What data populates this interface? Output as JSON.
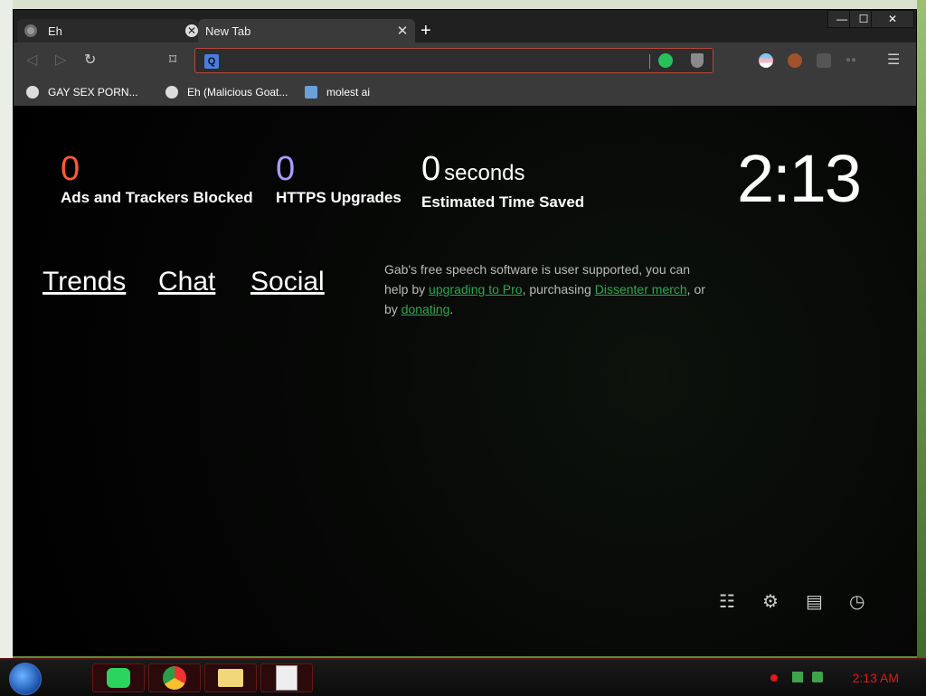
{
  "browser": {
    "tabs": [
      {
        "title": "Eh",
        "active": false
      },
      {
        "title": "New Tab",
        "active": true
      }
    ],
    "window_controls": {
      "minimize": "—",
      "maximize": "☐",
      "close": "✕"
    },
    "toolbar": {
      "address_value": "",
      "address_placeholder": "",
      "search_badge": "Q"
    },
    "bookmarks": [
      {
        "label": "GAY SEX PORN...",
        "icon": "ghost-icon"
      },
      {
        "label": "Eh (Malicious Goat...",
        "icon": "globe-icon"
      },
      {
        "label": "molest ai",
        "icon": "page-icon"
      }
    ]
  },
  "newtab": {
    "stats": [
      {
        "value": "0",
        "label": "Ads and Trackers Blocked",
        "color": "#ff5a36"
      },
      {
        "value": "0",
        "label": "HTTPS Upgrades",
        "color": "#a99cff"
      },
      {
        "value": "0",
        "unit": "seconds",
        "label": "Estimated Time Saved",
        "color": "#ffffff"
      }
    ],
    "clock": "2:13",
    "links": [
      "Trends",
      "Chat",
      "Social"
    ],
    "gab": {
      "text1": "Gab's free speech software is user supported, you can help by ",
      "link1": "upgrading to Pro",
      "text2": ", purchasing ",
      "link2": "Dissenter merch",
      "text3": ", or by ",
      "link3": "donating",
      "text4": "."
    },
    "bottom_icons": [
      "sliders-icon",
      "gear-icon",
      "bookmarks-icon",
      "history-icon"
    ]
  },
  "taskbar": {
    "time": "2:13 AM",
    "apps": [
      "chat-app-icon",
      "chrome-icon",
      "folder-icon",
      "document-icon"
    ]
  }
}
